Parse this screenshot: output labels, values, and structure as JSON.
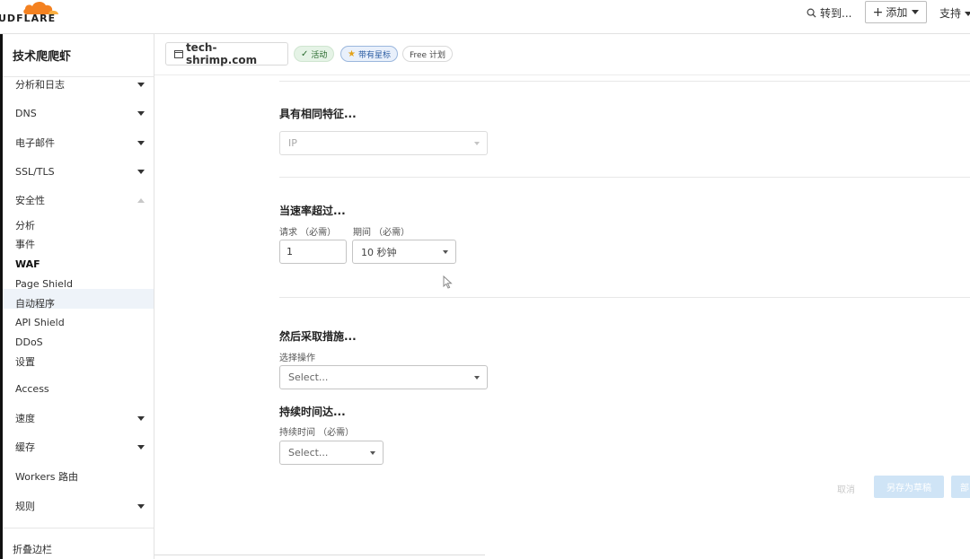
{
  "topbar": {
    "logo_text": "UDFLARE",
    "goto_label": "转到...",
    "add_label": "添加",
    "support_label": "支持"
  },
  "sidebar": {
    "account_name": "技术爬爬虾",
    "items": [
      {
        "label": "分析和日志",
        "expandable": true
      },
      {
        "label": "DNS",
        "expandable": true
      },
      {
        "label": "电子邮件",
        "expandable": true
      },
      {
        "label": "SSL/TLS",
        "expandable": true
      },
      {
        "label": "安全性",
        "expanded": true
      }
    ],
    "security_sub": [
      "分析",
      "事件",
      "WAF",
      "Page Shield",
      "自动程序",
      "API Shield",
      "DDoS",
      "设置"
    ],
    "active_item": "WAF",
    "more_items": [
      {
        "label": "Access",
        "expandable": false
      },
      {
        "label": "速度",
        "expandable": true
      },
      {
        "label": "缓存",
        "expandable": true
      },
      {
        "label": "Workers 路由",
        "expandable": false
      },
      {
        "label": "规则",
        "expandable": true
      }
    ],
    "collapse_label": "折叠边栏"
  },
  "domain": {
    "name": "tech-shrimp.com",
    "status_badge": "活动",
    "star_badge": "带有星标",
    "plan_badge": "Free 计划"
  },
  "form": {
    "characteristics_title": "具有相同特征...",
    "characteristics_value": "IP",
    "rate_title": "当速率超过...",
    "requests_label": "请求 （必需）",
    "requests_value": "1",
    "period_label": "期间 （必需）",
    "period_value": "10 秒钟",
    "action_title": "然后采取措施...",
    "action_label": "选择操作",
    "action_placeholder": "Select...",
    "duration_title": "持续时间达...",
    "duration_label": "持续时间 （必需）",
    "duration_placeholder": "Select..."
  },
  "actions": {
    "cancel_label": "取消",
    "save_draft_label": "另存为草稿",
    "deploy_label": "部"
  },
  "colors": {
    "logo_orange": "#f48120",
    "active_bg": "#eef3f9",
    "badge_green": "#2a6b2f",
    "badge_blue": "#2d5ea3",
    "button_disabled": "#cfe4f6"
  }
}
